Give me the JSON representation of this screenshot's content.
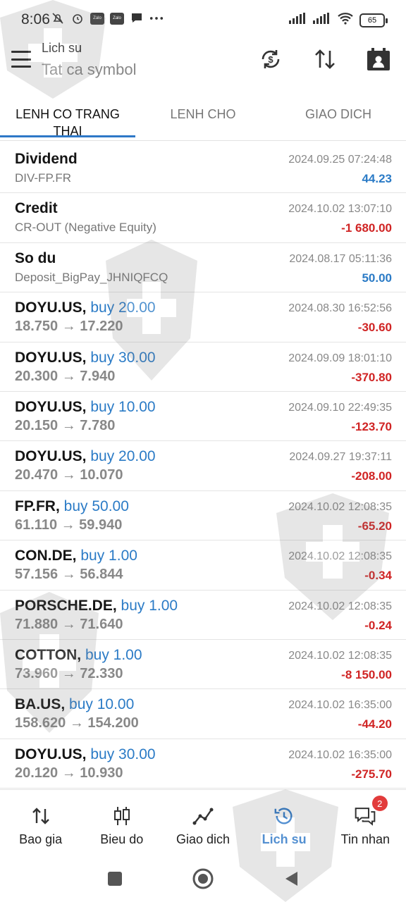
{
  "status_bar": {
    "time": "8:06",
    "battery": "65"
  },
  "header": {
    "subtitle": "Lich su",
    "title": "Tat ca symbol"
  },
  "tabs": [
    {
      "label": "LENH CO TRANG THAI"
    },
    {
      "label": "LENH CHO"
    },
    {
      "label": "GIAO DICH"
    }
  ],
  "rows": [
    {
      "title": "Dividend",
      "detail": "DIV-FP.FR",
      "time": "2024.09.25 07:24:48",
      "amount": "44.23",
      "sign": "pos"
    },
    {
      "title": "Credit",
      "detail": "CR-OUT (Negative Equity)",
      "time": "2024.10.02 13:07:10",
      "amount": "-1 680.00",
      "sign": "neg"
    },
    {
      "title": "So du",
      "detail": "Deposit_BigPay_JHNIQFCQ",
      "time": "2024.08.17 05:11:36",
      "amount": "50.00",
      "sign": "pos"
    },
    {
      "symbol": "DOYU.US,",
      "side": "buy 20.00",
      "prices": "18.750 → 17.220",
      "time": "2024.08.30 16:52:56",
      "amount": "-30.60",
      "sign": "neg"
    },
    {
      "symbol": "DOYU.US,",
      "side": "buy 30.00",
      "prices": "20.300 → 7.940",
      "time": "2024.09.09 18:01:10",
      "amount": "-370.80",
      "sign": "neg"
    },
    {
      "symbol": "DOYU.US,",
      "side": "buy 10.00",
      "prices": "20.150 → 7.780",
      "time": "2024.09.10 22:49:35",
      "amount": "-123.70",
      "sign": "neg"
    },
    {
      "symbol": "DOYU.US,",
      "side": "buy 20.00",
      "prices": "20.470 → 10.070",
      "time": "2024.09.27 19:37:11",
      "amount": "-208.00",
      "sign": "neg"
    },
    {
      "symbol": "FP.FR,",
      "side": "buy 50.00",
      "prices": "61.110 → 59.940",
      "time": "2024.10.02 12:08:35",
      "amount": "-65.20",
      "sign": "neg"
    },
    {
      "symbol": "CON.DE,",
      "side": "buy 1.00",
      "prices": "57.156 → 56.844",
      "time": "2024.10.02 12:08:35",
      "amount": "-0.34",
      "sign": "neg"
    },
    {
      "symbol": "PORSCHE.DE,",
      "side": "buy 1.00",
      "prices": "71.880 → 71.640",
      "time": "2024.10.02 12:08:35",
      "amount": "-0.24",
      "sign": "neg"
    },
    {
      "symbol": "COTTON,",
      "side": "buy 1.00",
      "prices": "73.960 → 72.330",
      "time": "2024.10.02 12:08:35",
      "amount": "-8 150.00",
      "sign": "neg"
    },
    {
      "symbol": "BA.US,",
      "side": "buy 10.00",
      "prices": "158.620 → 154.200",
      "time": "2024.10.02 16:35:00",
      "amount": "-44.20",
      "sign": "neg"
    },
    {
      "symbol": "DOYU.US,",
      "side": "buy 30.00",
      "prices": "20.120 → 10.930",
      "time": "2024.10.02 16:35:00",
      "amount": "-275.70",
      "sign": "neg"
    }
  ],
  "bottom_nav": [
    {
      "label": "Bao gia",
      "icon": "quotes-arrows-icon"
    },
    {
      "label": "Bieu do",
      "icon": "candlestick-icon"
    },
    {
      "label": "Giao dich",
      "icon": "trade-line-icon"
    },
    {
      "label": "Lich su",
      "icon": "history-icon",
      "active": true
    },
    {
      "label": "Tin nhan",
      "icon": "messages-icon",
      "badge": "2"
    }
  ],
  "colors": {
    "accent": "#2e78c7",
    "positive": "#2b7bc6",
    "negative": "#d02424"
  }
}
